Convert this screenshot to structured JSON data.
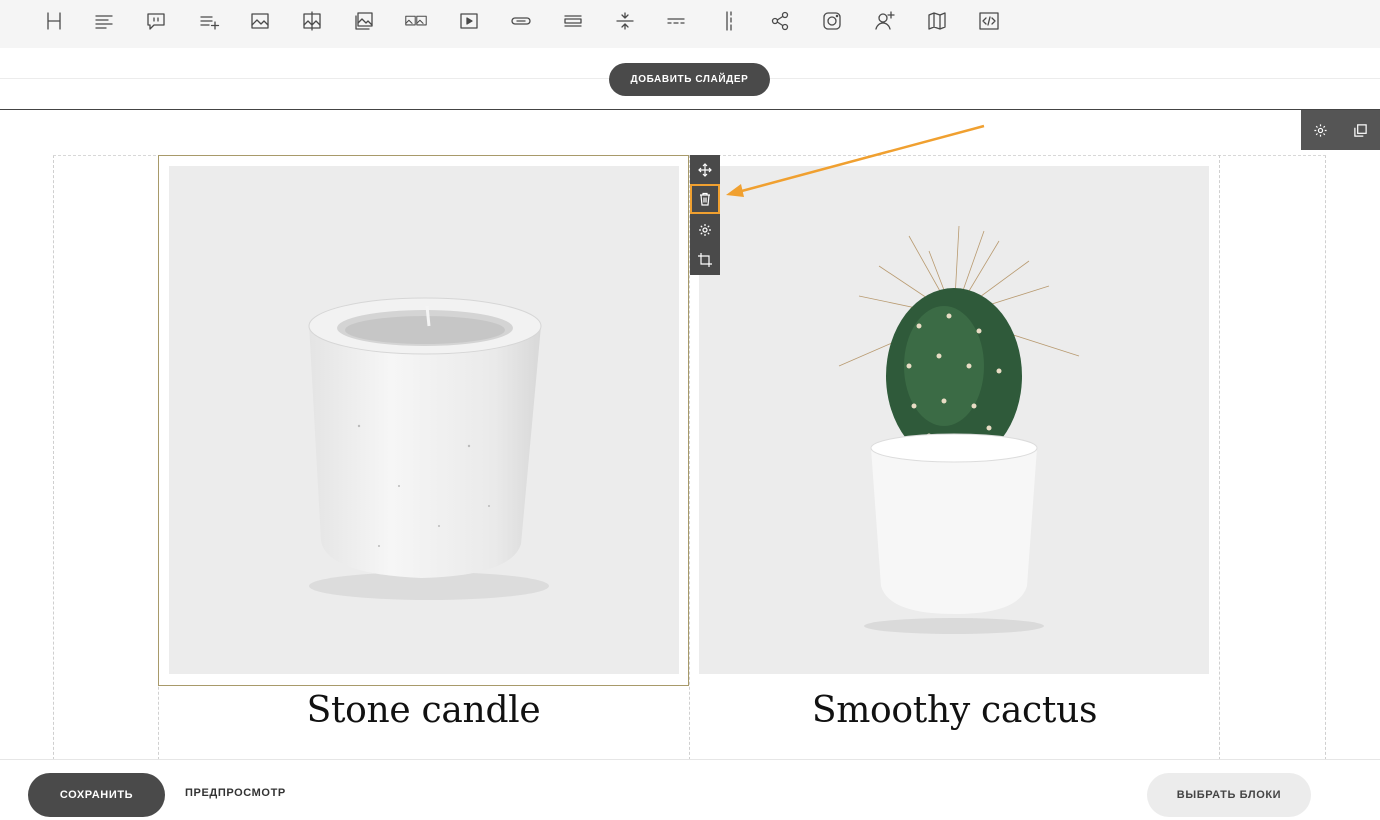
{
  "toolbar": {
    "tools": [
      {
        "icon": "heading-icon"
      },
      {
        "icon": "text-icon"
      },
      {
        "icon": "quote-icon"
      },
      {
        "icon": "list-add-icon"
      },
      {
        "icon": "image-icon"
      },
      {
        "icon": "image-compare-icon"
      },
      {
        "icon": "gallery-icon"
      },
      {
        "icon": "double-image-icon"
      },
      {
        "icon": "video-icon"
      },
      {
        "icon": "button-icon"
      },
      {
        "icon": "columns-lines-icon"
      },
      {
        "icon": "spacer-icon"
      },
      {
        "icon": "divider-icon"
      },
      {
        "icon": "vertical-divider-icon"
      },
      {
        "icon": "share-icon"
      },
      {
        "icon": "instagram-icon"
      },
      {
        "icon": "add-person-icon"
      },
      {
        "icon": "map-icon"
      },
      {
        "icon": "code-icon"
      }
    ]
  },
  "slider": {
    "add_label": "ДОБАВИТЬ СЛАЙДЕР"
  },
  "block_controls": {
    "settings_icon": "gear-icon",
    "duplicate_icon": "copy-icon"
  },
  "column_tools": [
    "move-icon",
    "trash-icon",
    "gear-icon",
    "crop-icon"
  ],
  "products": [
    {
      "title": "Stone candle",
      "image": "stone-candle-image"
    },
    {
      "title": "Smoothy cactus",
      "image": "cactus-image"
    }
  ],
  "annotation": {
    "color": "#f0a030"
  },
  "footer": {
    "save_label": "СОХРАНИТЬ",
    "preview_label": "ПРЕДПРОСМОТР",
    "choose_blocks_label": "ВЫБРАТЬ БЛОКИ"
  }
}
